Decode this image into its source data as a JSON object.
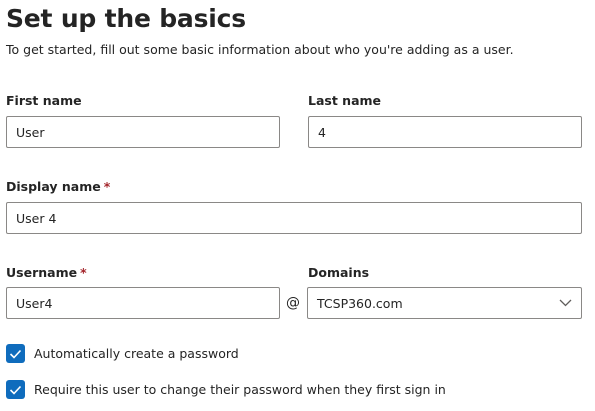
{
  "header": {
    "title": "Set up the basics",
    "subtitle": "To get started, fill out some basic information about who you're adding as a user."
  },
  "form": {
    "first_name": {
      "label": "First name",
      "value": "User"
    },
    "last_name": {
      "label": "Last name",
      "value": "4"
    },
    "display_name": {
      "label": "Display name",
      "required_mark": "*",
      "value": "User 4"
    },
    "username": {
      "label": "Username",
      "required_mark": "*",
      "value": "User4"
    },
    "at_symbol": "@",
    "domains": {
      "label": "Domains",
      "value": "TCSP360.com"
    },
    "auto_password": {
      "label": "Automatically create a password",
      "checked": true
    },
    "require_change": {
      "label": "Require this user to change their password when they first sign in",
      "checked": true
    }
  },
  "colors": {
    "accent": "#0f6cbd",
    "required": "#a4262c",
    "text": "#242424",
    "border": "#8a8886"
  },
  "icons": {
    "domains_dropdown": "chevron-down-icon",
    "checkbox": "checkmark-icon"
  }
}
